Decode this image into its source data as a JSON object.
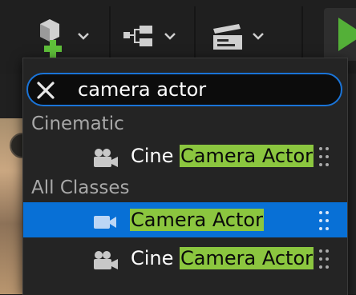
{
  "search": {
    "query": "camera actor"
  },
  "sections": [
    {
      "header": "Cinematic",
      "items": [
        {
          "prefix": "Cine ",
          "match": "Camera Actor",
          "icon": "film-camera-icon",
          "selected": false
        }
      ]
    },
    {
      "header": "All Classes",
      "items": [
        {
          "prefix": "",
          "match": "Camera Actor",
          "icon": "video-camera-icon",
          "selected": true
        },
        {
          "prefix": "Cine ",
          "match": "Camera Actor",
          "icon": "film-camera-icon",
          "selected": false
        }
      ]
    }
  ],
  "toolbar": {
    "buttons": [
      "add-actor-icon",
      "blueprint-icon",
      "cinematics-icon",
      "play-icon"
    ]
  },
  "colors": {
    "accent": "#0870d6",
    "match_highlight": "#8bc63f",
    "play_green": "#54b038"
  }
}
